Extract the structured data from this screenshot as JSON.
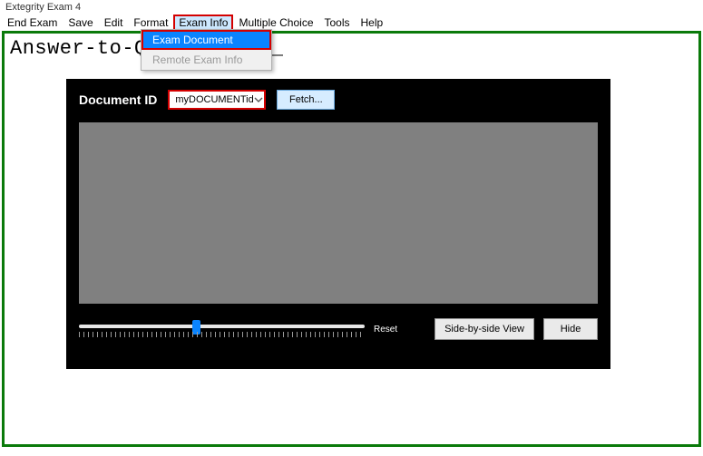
{
  "window": {
    "title": "Extegrity Exam 4"
  },
  "menubar": {
    "items": [
      {
        "label": "End Exam"
      },
      {
        "label": "Save"
      },
      {
        "label": "Edit"
      },
      {
        "label": "Format"
      },
      {
        "label": "Exam Info"
      },
      {
        "label": "Multiple Choice"
      },
      {
        "label": "Tools"
      },
      {
        "label": "Help"
      }
    ]
  },
  "dropdown": {
    "items": [
      {
        "label": "Exam Document"
      },
      {
        "label": "Remote Exam Info"
      }
    ]
  },
  "editor": {
    "visible_text": "Answer-to-Question-_1_"
  },
  "doc_panel": {
    "label": "Document ID",
    "select_value": "myDOCUMENTid",
    "fetch_label": "Fetch...",
    "reset_label": "Reset",
    "side_by_side_label": "Side-by-side View",
    "hide_label": "Hide"
  },
  "colors": {
    "highlight_border": "#d40000",
    "frame_border": "#0a7a0a",
    "accent_blue": "#0a84ff"
  }
}
